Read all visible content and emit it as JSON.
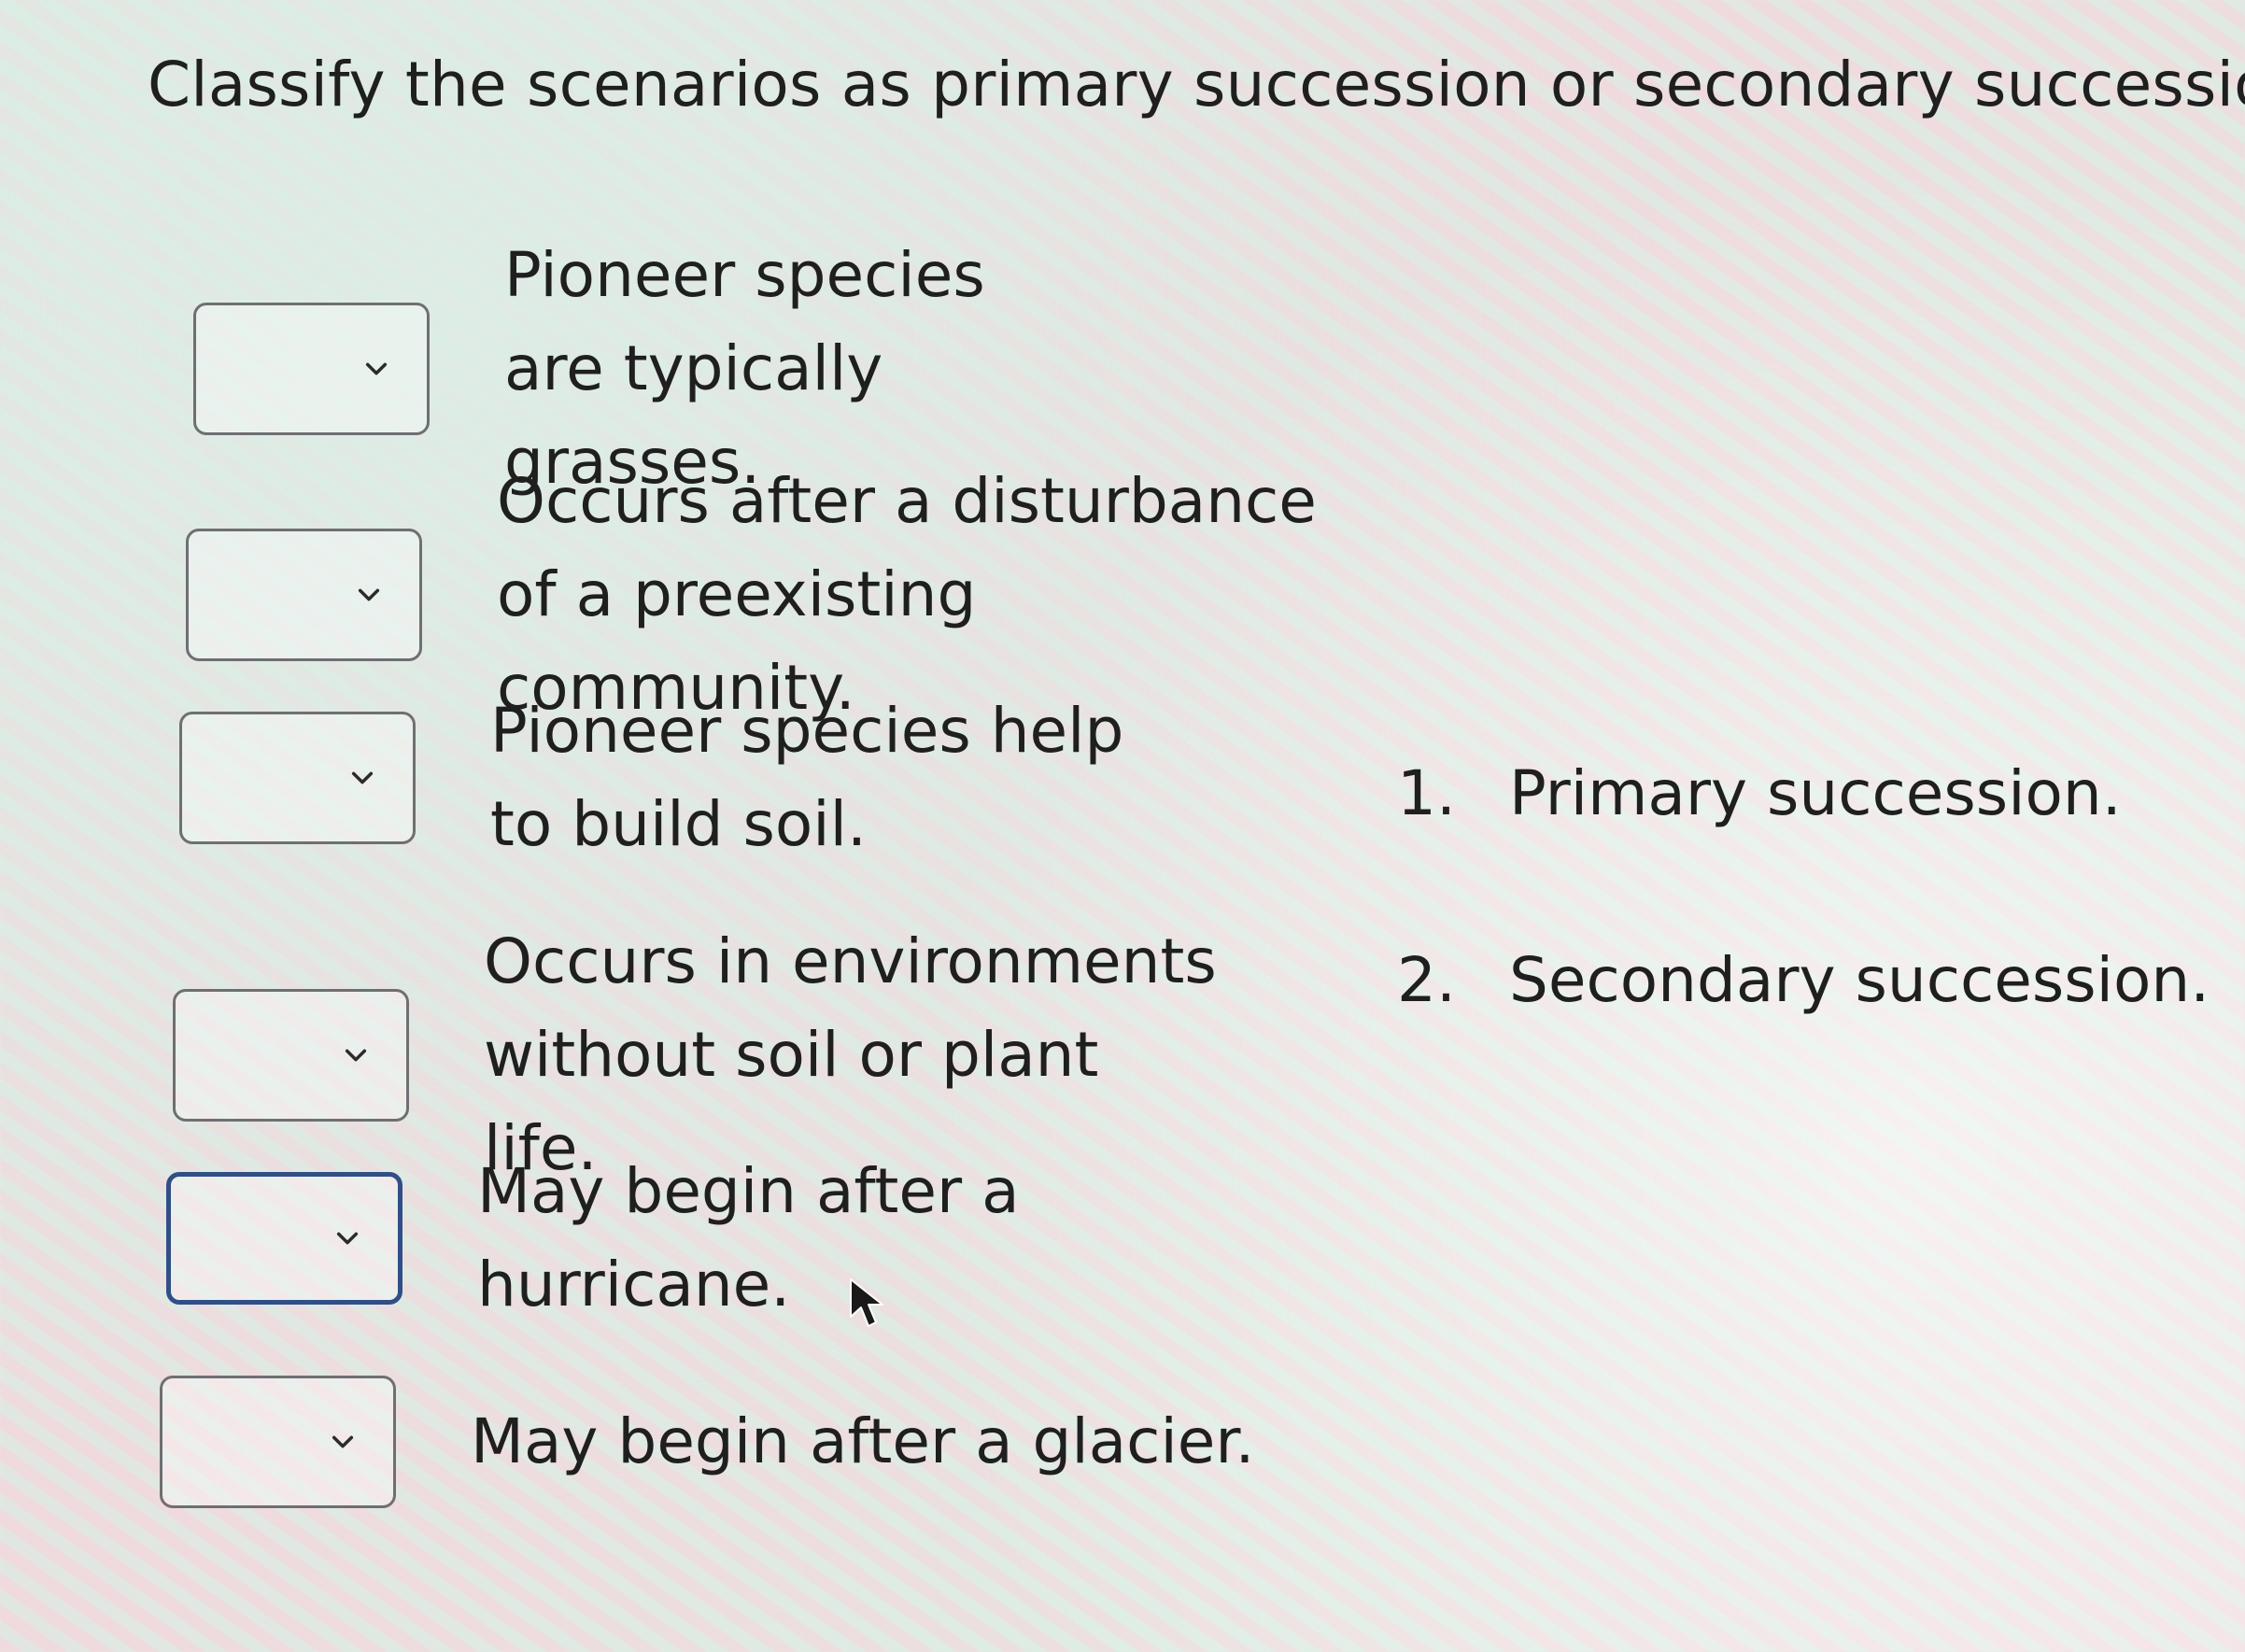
{
  "question": {
    "title": "Classify the scenarios as primary succession or secondary succession."
  },
  "items": [
    {
      "statement": "Pioneer species are typically grasses.",
      "selected": ""
    },
    {
      "statement": "Occurs after a disturbance of a preexisting community.",
      "selected": ""
    },
    {
      "statement": "Pioneer species help to build soil.",
      "selected": ""
    },
    {
      "statement": "Occurs in environments without soil or plant life.",
      "selected": ""
    },
    {
      "statement": "May begin after a hurricane.",
      "selected": ""
    },
    {
      "statement": "May begin after a glacier.",
      "selected": ""
    }
  ],
  "choices": [
    {
      "num": "1.",
      "label": "Primary succession."
    },
    {
      "num": "2.",
      "label": "Secondary succession."
    }
  ],
  "icons": {
    "dropdown": "chevron-down-icon",
    "cursor": "mouse-pointer-icon"
  },
  "colors": {
    "dropdown_border": "#6f6f72",
    "dropdown_focus_border": "#2f4f86",
    "text": "#1f1f1f"
  }
}
